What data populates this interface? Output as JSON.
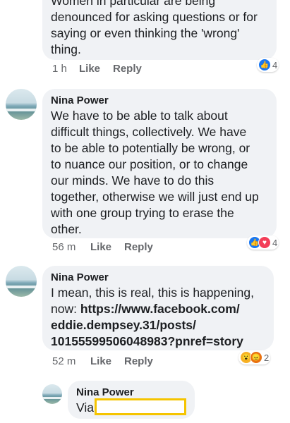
{
  "comments": [
    {
      "author": "",
      "text": "Women in particular are being\ndenounced for asking questions or for\nsaying or even thinking the 'wrong'\nthing.",
      "time": "1 h",
      "like": "Like",
      "reply": "Reply",
      "reactions": {
        "icons": [
          "like-icon"
        ],
        "count": "4"
      }
    },
    {
      "author": "Nina Power",
      "text": "We have to be able to talk about\ndifficult things, collectively. We have\nto be able to potentially be wrong, or\nto nuance our position, or to change\nour minds. We have to do this\ntogether, otherwise we will just end up\nwith one group trying to erase the\nother.",
      "time": "56 m",
      "like": "Like",
      "reply": "Reply",
      "reactions": {
        "icons": [
          "like-icon",
          "love-icon"
        ],
        "count": "4"
      }
    },
    {
      "author": "Nina Power",
      "text_prefix": "I mean, this is real, this is happening,\nnow: ",
      "link": "https://www.facebook.com/\neddie.dempsey.31/posts/\n10155599506048983?pnref=story",
      "time": "52 m",
      "like": "Like",
      "reply": "Reply",
      "reactions": {
        "icons": [
          "wow-icon",
          "angry-icon"
        ],
        "count": "2"
      }
    },
    {
      "author": "Nina Power",
      "text": "Via"
    }
  ],
  "colors": {
    "bubble": "#f0f2f5",
    "like": "#1877f2",
    "love": "#f33e58",
    "wow": "#f7b125",
    "redaction": "#f5c400"
  }
}
